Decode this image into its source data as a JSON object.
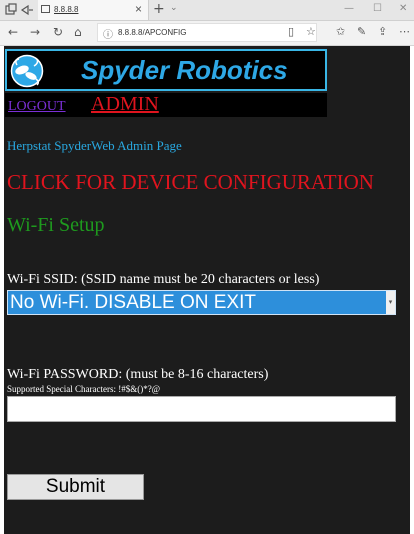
{
  "browser": {
    "tab_title": "8.8.8.8",
    "tab_close": "×",
    "new_tab": "+",
    "tab_menu": "⌄",
    "url": "8.8.8.8/APCONFIG",
    "nav": {
      "back": "←",
      "forward": "→",
      "refresh": "↻",
      "home": "⌂"
    },
    "address_icons": {
      "info": "ⓘ",
      "reading_view": "▯",
      "favorite": "☆"
    },
    "toolbar_icons": {
      "favorites": "✩",
      "notes": "✎",
      "share": "⇪",
      "more": "⋯"
    },
    "window_controls": {
      "minimize": "—",
      "maximize": "☐",
      "close": "✕"
    }
  },
  "header": {
    "logo_text": "Spyder Robotics",
    "logout": "LOGOUT",
    "admin": "ADMIN"
  },
  "main": {
    "subtitle": "Herpstat SpyderWeb Admin Page",
    "config_link": "CLICK FOR DEVICE CONFIGURATION",
    "wifi_heading": "Wi-Fi Setup",
    "ssid_label": "Wi-Fi SSID: (SSID name must be 20 characters or less)",
    "ssid_selected": "No Wi-Fi. DISABLE ON EXIT",
    "password_label": "Wi-Fi PASSWORD: (must be 8-16 characters)",
    "special_chars": "Supported Special Characters: !#$&()*?@",
    "password_value": "",
    "submit": "Submit"
  },
  "colors": {
    "page_bg": "#1c1c1c",
    "brand_blue": "#2ea8e6",
    "link_red": "#e0141e",
    "logout_purple": "#7b2fd6",
    "heading_green": "#1e9a1e",
    "select_blue": "#2d8fdb"
  }
}
